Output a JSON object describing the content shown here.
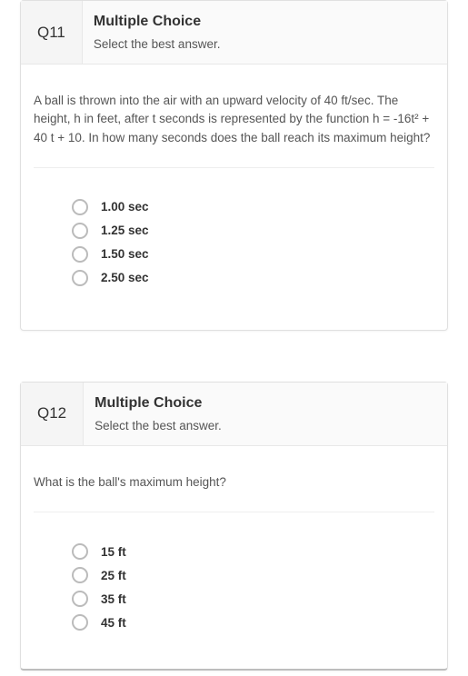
{
  "questions": [
    {
      "number": "Q11",
      "type_label": "Multiple Choice",
      "instruction": "Select the best answer.",
      "prompt": "A ball is thrown into the air with an upward velocity of 40 ft/sec.  The height, h in feet, after t seconds is represented by the function h = -16t² + 40 t + 10.  In how many seconds does the ball reach its maximum height?",
      "options": [
        "1.00 sec",
        "1.25 sec",
        "1.50 sec",
        "2.50 sec"
      ]
    },
    {
      "number": "Q12",
      "type_label": "Multiple Choice",
      "instruction": "Select the best answer.",
      "prompt": "What is the ball's maximum height?",
      "options": [
        "15 ft",
        "25 ft",
        "35 ft",
        "45 ft"
      ]
    }
  ]
}
